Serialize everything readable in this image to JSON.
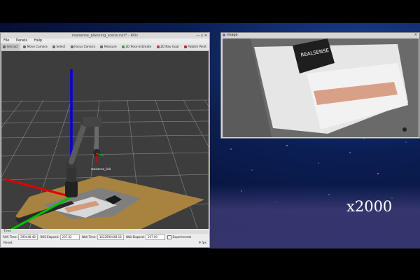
{
  "speed_label": "x2000",
  "rviz": {
    "title": "realsense_planning_scene.rviz* - RViz",
    "window_controls": "— ▫ ✕",
    "menu": [
      "File",
      "Panels",
      "Help"
    ],
    "toolbar": [
      {
        "label": "Interact",
        "active": true
      },
      {
        "label": "Move Camera",
        "active": false
      },
      {
        "label": "Select",
        "active": false
      },
      {
        "label": "Focus Camera",
        "active": false
      },
      {
        "label": "Measure",
        "active": false
      },
      {
        "label": "2D Pose Estimate",
        "active": false
      },
      {
        "label": "2D Nav Goal",
        "active": false
      },
      {
        "label": "Publish Point",
        "active": false
      }
    ],
    "robot_label": "realsense_link",
    "time_panel_label": "Time",
    "time_fields": [
      {
        "label": "ROS Time:",
        "value": "290448.48"
      },
      {
        "label": "ROS Elapsed:",
        "value": "207.02"
      },
      {
        "label": "Wall Time:",
        "value": "1622990448.18"
      },
      {
        "label": "Wall Elapsed:",
        "value": "207.00"
      }
    ],
    "experimental_label": "Experimental",
    "reset_label": "Reset",
    "fps": "9 fps"
  },
  "image_window": {
    "title": "image",
    "close_glyph": "✕",
    "box_brand": "REALSENSE"
  },
  "colors": {
    "desktop_dark": "#071034",
    "viewport_bg": "#3d3d3d",
    "axis_red": "#e00000",
    "axis_green": "#00c000",
    "axis_blue": "#0000e6",
    "table_wood": "#a8823f"
  }
}
